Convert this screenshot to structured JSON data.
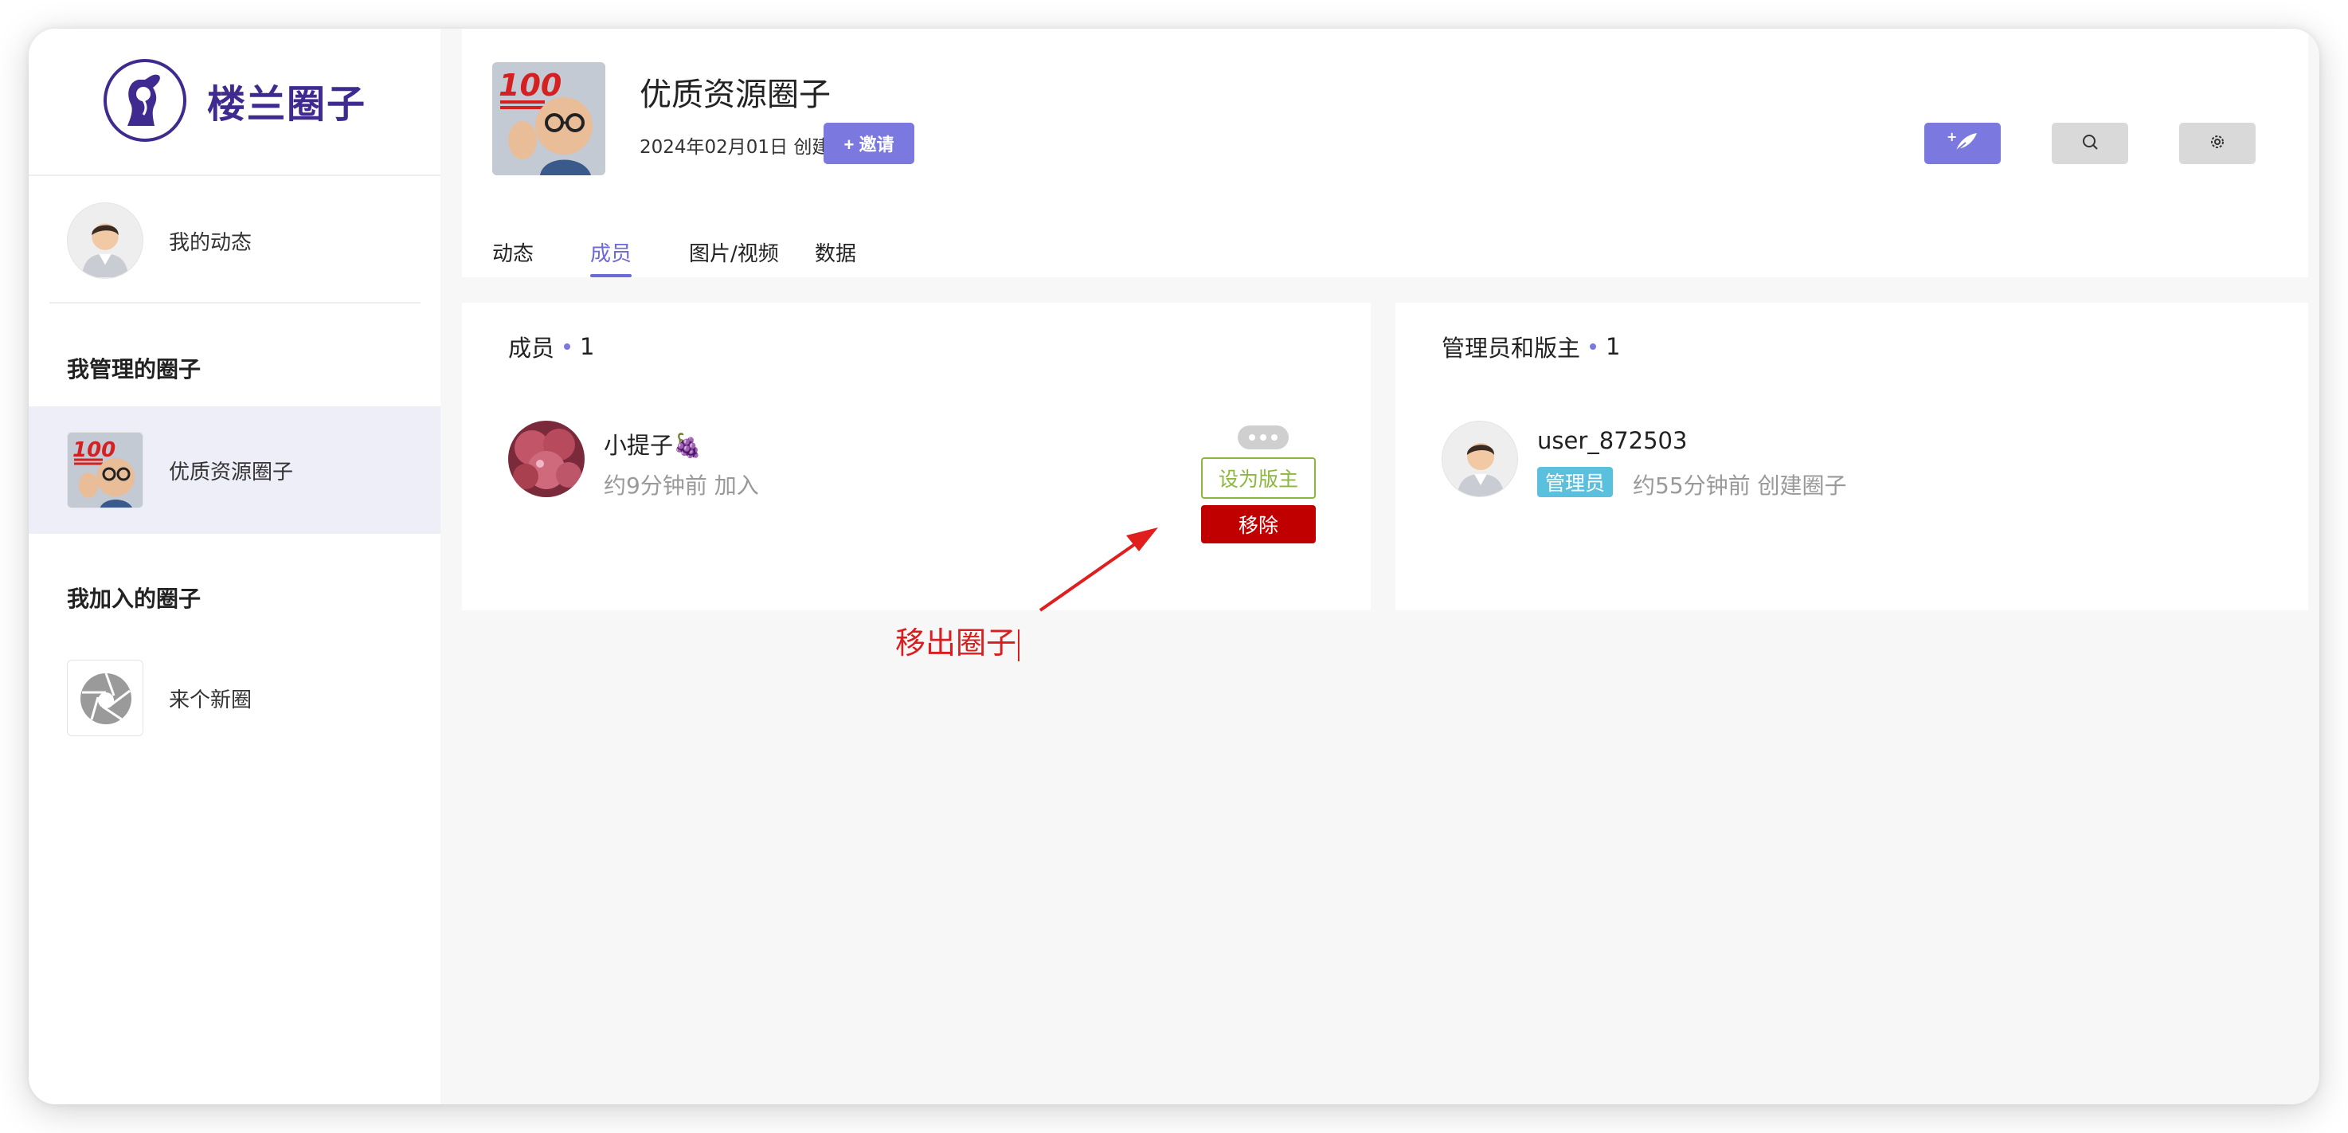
{
  "brand": {
    "name": "楼兰圈子"
  },
  "sidebar": {
    "my_feed": {
      "label": "我的动态"
    },
    "managed_heading": "我管理的圈子",
    "managed_items": [
      {
        "label": "优质资源圈子"
      }
    ],
    "joined_heading": "我加入的圈子",
    "joined_items": [
      {
        "label": "来个新圈"
      }
    ]
  },
  "header": {
    "title": "优质资源圈子",
    "created": "2024年02月01日 创建",
    "invite_label": "+ 邀请",
    "tools": [
      {
        "name": "post-icon",
        "color": "#7b79e0"
      },
      {
        "name": "search-icon",
        "color": "#d9d9d9"
      },
      {
        "name": "gear-icon",
        "color": "#d9d9d9"
      }
    ]
  },
  "tabs": [
    {
      "label": "动态",
      "active": false
    },
    {
      "label": "成员",
      "active": true
    },
    {
      "label": "图片/视频",
      "active": false
    },
    {
      "label": "数据",
      "active": false
    }
  ],
  "members_panel": {
    "title": "成员",
    "count": "1",
    "members": [
      {
        "name": "小提子🍇",
        "meta": "约9分钟前 加入",
        "set_moderator_label": "设为版主",
        "remove_label": "移除"
      }
    ]
  },
  "admins_panel": {
    "title": "管理员和版主",
    "count": "1",
    "admins": [
      {
        "name": "user_872503",
        "badge": "管理员",
        "meta": "约55分钟前 创建圈子"
      }
    ]
  },
  "annotation": {
    "text": "移出圈子",
    "color": "#d81e1e"
  },
  "colors": {
    "accent": "#7b79e0",
    "brand": "#3f2a8f",
    "danger": "#c00000",
    "moderator": "#8bb83c",
    "badge": "#5bc0de"
  }
}
